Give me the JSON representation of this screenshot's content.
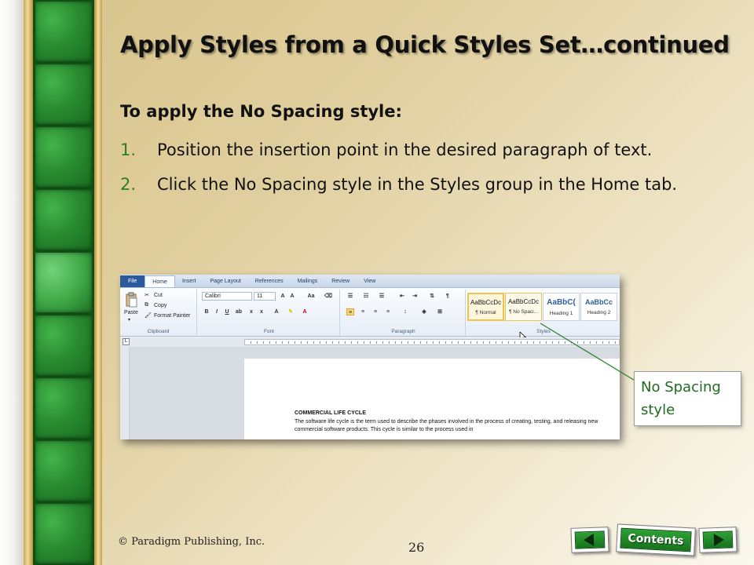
{
  "slide": {
    "title": "Apply Styles from a Quick Styles Set…continued",
    "subheading": "To apply the No Spacing style:",
    "steps": [
      {
        "num": "1.",
        "text": "Position the insertion point in the desired paragraph of text."
      },
      {
        "num": "2.",
        "text": "Click the No Spacing style in the Styles group in the Home tab."
      }
    ]
  },
  "word": {
    "tabs": [
      "File",
      "Home",
      "Insert",
      "Page Layout",
      "References",
      "Mailings",
      "Review",
      "View"
    ],
    "clipboard": {
      "paste": "Paste",
      "cut": "Cut",
      "copy": "Copy",
      "format_painter": "Format Painter",
      "label": "Clipboard"
    },
    "font": {
      "name": "Calibri",
      "size": "11",
      "label": "Font"
    },
    "paragraph": {
      "label": "Paragraph"
    },
    "styles": {
      "label": "Styles",
      "items": [
        {
          "preview": "AaBbCcDc",
          "name": "¶ Normal"
        },
        {
          "preview": "AaBbCcDc",
          "name": "¶ No Spaci..."
        },
        {
          "preview": "AaBbC(",
          "name": "Heading 1"
        },
        {
          "preview": "AaBbCc",
          "name": "Heading 2"
        }
      ]
    },
    "document": {
      "heading": "COMMERCIAL LIFE CYCLE",
      "body": "The software life cycle is the term used to describe the phases involved in the process of creating, testing, and releasing new commercial software products. This cycle is similar to the process used in"
    }
  },
  "callout": {
    "text": "No Spacing style"
  },
  "footer": {
    "copyright": "© Paradigm Publishing, Inc.",
    "page_number": "26",
    "contents_label": "Contents"
  },
  "colors": {
    "accent_green": "#2b7f2b",
    "callout_text": "#1f6b1f",
    "button_green": "#1f8a26"
  }
}
